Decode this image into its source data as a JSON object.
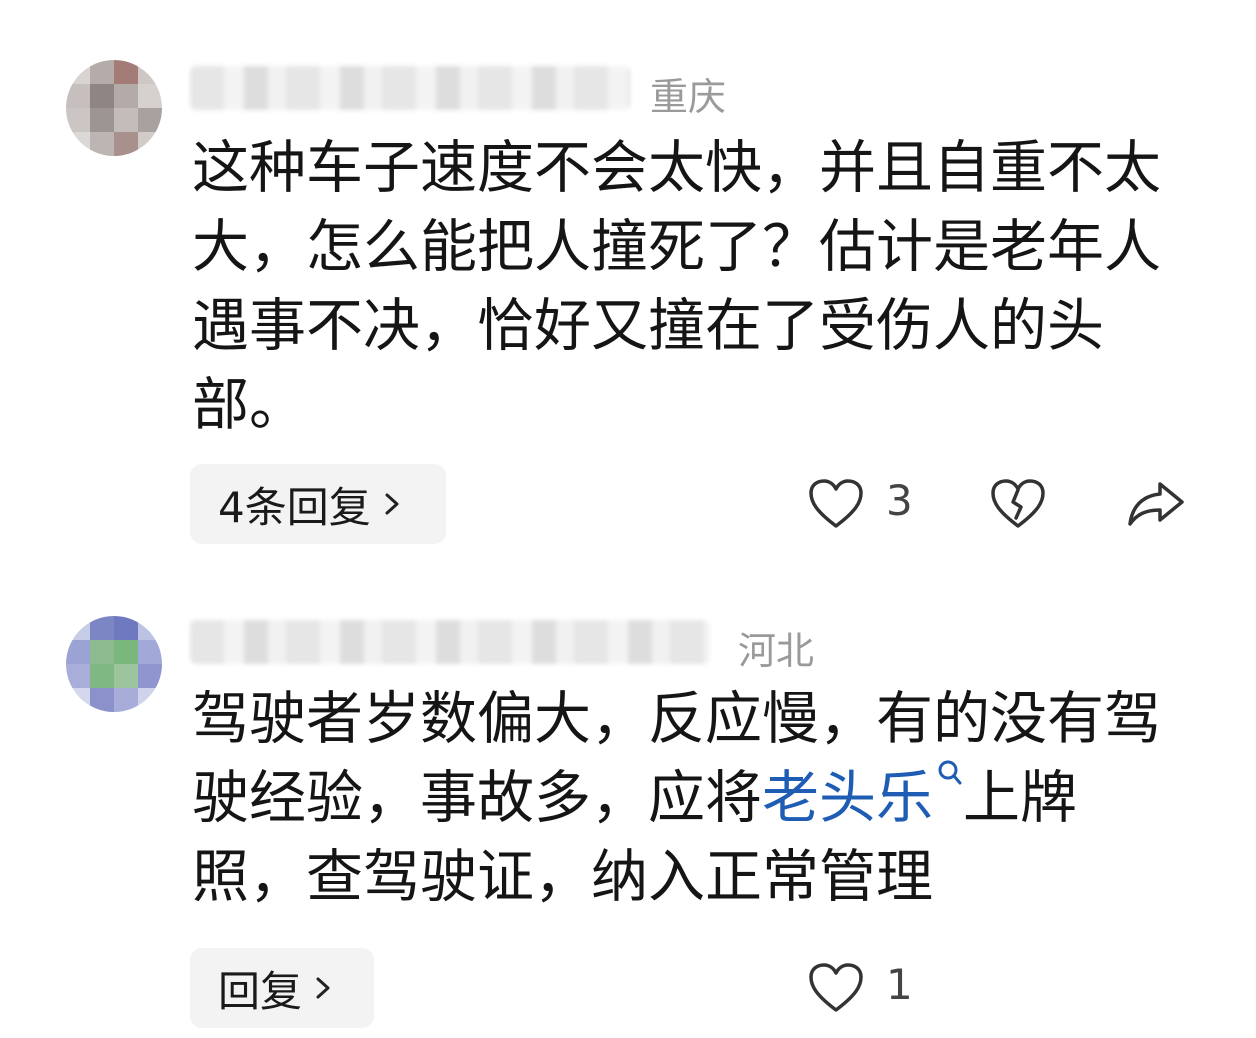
{
  "comments": [
    {
      "location": "重庆",
      "text": "这种车子速度不会太快，并且自重不太大，怎么能把人撞死了？估计是老年人遇事不决，恰好又撞在了受伤人的头部。",
      "reply_label": "4条回复",
      "like_count": "3",
      "icons": [
        "like-icon",
        "dislike-icon",
        "share-icon"
      ]
    },
    {
      "location": "河北",
      "text_before": "驾驶者岁数偏大，反应慢，有的没有驾驶经验，事故多，应将",
      "link_text": "老头乐",
      "text_after": "上牌照，查驾驶证，纳入正常管理",
      "reply_label": "回复",
      "like_count": "1",
      "icons": [
        "like-icon"
      ]
    }
  ],
  "colors": {
    "link": "#1f5db4",
    "location": "#9a9a9a",
    "reply_bg": "#f3f3f3"
  }
}
